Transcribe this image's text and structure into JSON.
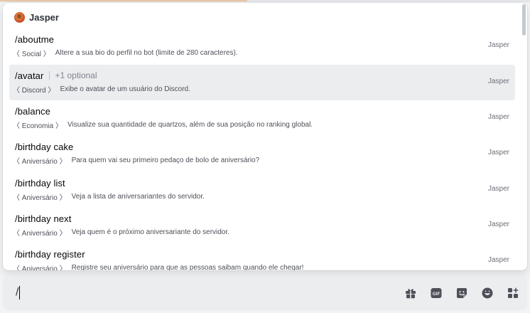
{
  "autocomplete": {
    "section_title": "Jasper",
    "commands": [
      {
        "name": "/aboutme",
        "option_hint": "",
        "category": "〈 Social 〉",
        "description": "Altere a sua bio do perfil no bot (limite de 280 caracteres).",
        "source": "Jasper",
        "selected": false
      },
      {
        "name": "/avatar",
        "option_hint": "+1 optional",
        "category": "〈 Discord 〉",
        "description": "Exibe o avatar de um usuário do Discord.",
        "source": "Jasper",
        "selected": true
      },
      {
        "name": "/balance",
        "option_hint": "",
        "category": "〈 Economia 〉",
        "description": "Visualize sua quantidade de quartzos, além de sua posição no ranking global.",
        "source": "Jasper",
        "selected": false
      },
      {
        "name": "/birthday cake",
        "option_hint": "",
        "category": "〈 Aniversário 〉",
        "description": "Para quem vai seu primeiro pedaço de bolo de aniversário?",
        "source": "Jasper",
        "selected": false
      },
      {
        "name": "/birthday list",
        "option_hint": "",
        "category": "〈 Aniversário 〉",
        "description": "Veja a lista de aniversariantes do servidor.",
        "source": "Jasper",
        "selected": false
      },
      {
        "name": "/birthday next",
        "option_hint": "",
        "category": "〈 Aniversário 〉",
        "description": "Veja quem é o próximo aniversariante do servidor.",
        "source": "Jasper",
        "selected": false
      },
      {
        "name": "/birthday register",
        "option_hint": "",
        "category": "〈 Aniversário 〉",
        "description": "Registre seu aniversário para que as pessoas saibam quando ele chegar!",
        "source": "Jasper",
        "selected": false
      }
    ]
  },
  "chat_input": {
    "value": "/",
    "buttons": [
      {
        "name": "gift-icon"
      },
      {
        "name": "gif-icon",
        "label": "GIF"
      },
      {
        "name": "sticker-icon"
      },
      {
        "name": "emoji-icon"
      },
      {
        "name": "apps-icon"
      }
    ]
  }
}
